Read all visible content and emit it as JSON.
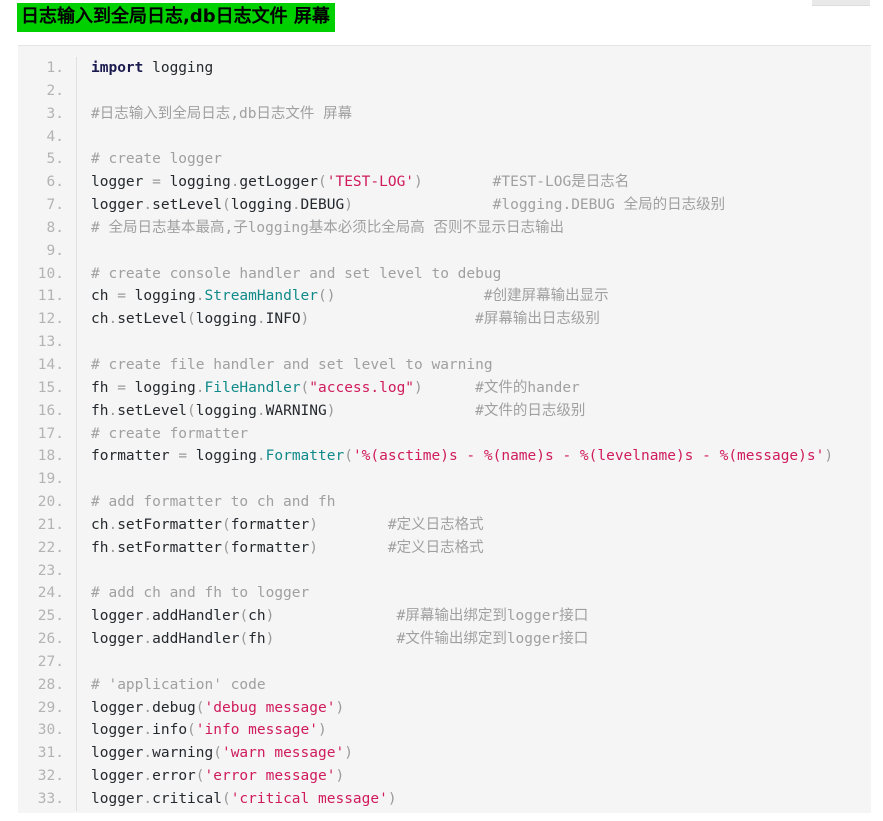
{
  "page_title": "日志输入到全局日志,db日志文件  屏幕",
  "colors": {
    "title_highlight": "#00d000",
    "code_background": "#f5f5f5",
    "gutter_text": "#b3b3b3",
    "comment": "#a0a0a0",
    "string": "#d01b5c",
    "keyword": "#1a1a4e",
    "class_name": "#118a8a",
    "code_text": "#24292e"
  },
  "code_block": {
    "language": "python",
    "line_count": 33,
    "line_number_suffix": ".",
    "lines": [
      {
        "n": "1",
        "tokens": [
          {
            "t": "import",
            "c": "kw"
          },
          {
            "t": " logging",
            "c": "nm"
          }
        ]
      },
      {
        "n": "2",
        "tokens": []
      },
      {
        "n": "3",
        "tokens": [
          {
            "t": "#日志输入到全局日志,db日志文件 屏幕",
            "c": "cm"
          }
        ]
      },
      {
        "n": "4",
        "tokens": []
      },
      {
        "n": "5",
        "tokens": [
          {
            "t": "# create logger",
            "c": "cm"
          }
        ]
      },
      {
        "n": "6",
        "tokens": [
          {
            "t": "logger ",
            "c": "nm"
          },
          {
            "t": "= ",
            "c": "pun"
          },
          {
            "t": "logging",
            "c": "nm"
          },
          {
            "t": ".",
            "c": "pun"
          },
          {
            "t": "getLogger",
            "c": "nm"
          },
          {
            "t": "(",
            "c": "pun"
          },
          {
            "t": "'TEST-LOG'",
            "c": "str"
          },
          {
            "t": ")",
            "c": "pun"
          },
          {
            "t": "        ",
            "c": "nm"
          },
          {
            "t": "#TEST-LOG是日志名",
            "c": "cm"
          }
        ]
      },
      {
        "n": "7",
        "tokens": [
          {
            "t": "logger",
            "c": "nm"
          },
          {
            "t": ".",
            "c": "pun"
          },
          {
            "t": "setLevel",
            "c": "nm"
          },
          {
            "t": "(",
            "c": "pun"
          },
          {
            "t": "logging",
            "c": "nm"
          },
          {
            "t": ".",
            "c": "pun"
          },
          {
            "t": "DEBUG",
            "c": "nm"
          },
          {
            "t": ")",
            "c": "pun"
          },
          {
            "t": "                ",
            "c": "nm"
          },
          {
            "t": "#logging.DEBUG 全局的日志级别",
            "c": "cm"
          }
        ]
      },
      {
        "n": "8",
        "tokens": [
          {
            "t": "# 全局日志基本最高,子logging基本必须比全局高 否则不显示日志输出",
            "c": "cm"
          }
        ]
      },
      {
        "n": "9",
        "tokens": []
      },
      {
        "n": "10",
        "tokens": [
          {
            "t": "# create console handler and set level to debug",
            "c": "cm"
          }
        ]
      },
      {
        "n": "11",
        "tokens": [
          {
            "t": "ch ",
            "c": "nm"
          },
          {
            "t": "= ",
            "c": "pun"
          },
          {
            "t": "logging",
            "c": "nm"
          },
          {
            "t": ".",
            "c": "pun"
          },
          {
            "t": "StreamHandler",
            "c": "cls"
          },
          {
            "t": "()",
            "c": "pun"
          },
          {
            "t": "                 ",
            "c": "nm"
          },
          {
            "t": "#创建屏幕输出显示",
            "c": "cm"
          }
        ]
      },
      {
        "n": "12",
        "tokens": [
          {
            "t": "ch",
            "c": "nm"
          },
          {
            "t": ".",
            "c": "pun"
          },
          {
            "t": "setLevel",
            "c": "nm"
          },
          {
            "t": "(",
            "c": "pun"
          },
          {
            "t": "logging",
            "c": "nm"
          },
          {
            "t": ".",
            "c": "pun"
          },
          {
            "t": "INFO",
            "c": "nm"
          },
          {
            "t": ")",
            "c": "pun"
          },
          {
            "t": "                   ",
            "c": "nm"
          },
          {
            "t": "#屏幕输出日志级别",
            "c": "cm"
          }
        ]
      },
      {
        "n": "13",
        "tokens": []
      },
      {
        "n": "14",
        "tokens": [
          {
            "t": "# create file handler and set level to warning",
            "c": "cm"
          }
        ]
      },
      {
        "n": "15",
        "tokens": [
          {
            "t": "fh ",
            "c": "nm"
          },
          {
            "t": "= ",
            "c": "pun"
          },
          {
            "t": "logging",
            "c": "nm"
          },
          {
            "t": ".",
            "c": "pun"
          },
          {
            "t": "FileHandler",
            "c": "cls"
          },
          {
            "t": "(",
            "c": "pun"
          },
          {
            "t": "\"access.log\"",
            "c": "str"
          },
          {
            "t": ")",
            "c": "pun"
          },
          {
            "t": "      ",
            "c": "nm"
          },
          {
            "t": "#文件的hander",
            "c": "cm"
          }
        ]
      },
      {
        "n": "16",
        "tokens": [
          {
            "t": "fh",
            "c": "nm"
          },
          {
            "t": ".",
            "c": "pun"
          },
          {
            "t": "setLevel",
            "c": "nm"
          },
          {
            "t": "(",
            "c": "pun"
          },
          {
            "t": "logging",
            "c": "nm"
          },
          {
            "t": ".",
            "c": "pun"
          },
          {
            "t": "WARNING",
            "c": "nm"
          },
          {
            "t": ")",
            "c": "pun"
          },
          {
            "t": "                ",
            "c": "nm"
          },
          {
            "t": "#文件的日志级别",
            "c": "cm"
          }
        ]
      },
      {
        "n": "17",
        "tokens": [
          {
            "t": "# create formatter",
            "c": "cm"
          }
        ]
      },
      {
        "n": "18",
        "tokens": [
          {
            "t": "formatter ",
            "c": "nm"
          },
          {
            "t": "= ",
            "c": "pun"
          },
          {
            "t": "logging",
            "c": "nm"
          },
          {
            "t": ".",
            "c": "pun"
          },
          {
            "t": "Formatter",
            "c": "cls"
          },
          {
            "t": "(",
            "c": "pun"
          },
          {
            "t": "'%(asctime)s - %(name)s - %(levelname)s - %(message)s'",
            "c": "str"
          },
          {
            "t": ")",
            "c": "pun"
          }
        ]
      },
      {
        "n": "19",
        "tokens": []
      },
      {
        "n": "20",
        "tokens": [
          {
            "t": "# add formatter to ch and fh",
            "c": "cm"
          }
        ]
      },
      {
        "n": "21",
        "tokens": [
          {
            "t": "ch",
            "c": "nm"
          },
          {
            "t": ".",
            "c": "pun"
          },
          {
            "t": "setFormatter",
            "c": "nm"
          },
          {
            "t": "(",
            "c": "pun"
          },
          {
            "t": "formatter",
            "c": "nm"
          },
          {
            "t": ")",
            "c": "pun"
          },
          {
            "t": "        ",
            "c": "nm"
          },
          {
            "t": "#定义日志格式",
            "c": "cm"
          }
        ]
      },
      {
        "n": "22",
        "tokens": [
          {
            "t": "fh",
            "c": "nm"
          },
          {
            "t": ".",
            "c": "pun"
          },
          {
            "t": "setFormatter",
            "c": "nm"
          },
          {
            "t": "(",
            "c": "pun"
          },
          {
            "t": "formatter",
            "c": "nm"
          },
          {
            "t": ")",
            "c": "pun"
          },
          {
            "t": "        ",
            "c": "nm"
          },
          {
            "t": "#定义日志格式",
            "c": "cm"
          }
        ]
      },
      {
        "n": "23",
        "tokens": []
      },
      {
        "n": "24",
        "tokens": [
          {
            "t": "# add ch and fh to logger",
            "c": "cm"
          }
        ]
      },
      {
        "n": "25",
        "tokens": [
          {
            "t": "logger",
            "c": "nm"
          },
          {
            "t": ".",
            "c": "pun"
          },
          {
            "t": "addHandler",
            "c": "nm"
          },
          {
            "t": "(",
            "c": "pun"
          },
          {
            "t": "ch",
            "c": "nm"
          },
          {
            "t": ")",
            "c": "pun"
          },
          {
            "t": "              ",
            "c": "nm"
          },
          {
            "t": "#屏幕输出绑定到logger接口",
            "c": "cm"
          }
        ]
      },
      {
        "n": "26",
        "tokens": [
          {
            "t": "logger",
            "c": "nm"
          },
          {
            "t": ".",
            "c": "pun"
          },
          {
            "t": "addHandler",
            "c": "nm"
          },
          {
            "t": "(",
            "c": "pun"
          },
          {
            "t": "fh",
            "c": "nm"
          },
          {
            "t": ")",
            "c": "pun"
          },
          {
            "t": "              ",
            "c": "nm"
          },
          {
            "t": "#文件输出绑定到logger接口",
            "c": "cm"
          }
        ]
      },
      {
        "n": "27",
        "tokens": []
      },
      {
        "n": "28",
        "tokens": [
          {
            "t": "# 'application' code",
            "c": "cm"
          }
        ]
      },
      {
        "n": "29",
        "tokens": [
          {
            "t": "logger",
            "c": "nm"
          },
          {
            "t": ".",
            "c": "pun"
          },
          {
            "t": "debug",
            "c": "nm"
          },
          {
            "t": "(",
            "c": "pun"
          },
          {
            "t": "'debug message'",
            "c": "str"
          },
          {
            "t": ")",
            "c": "pun"
          }
        ]
      },
      {
        "n": "30",
        "tokens": [
          {
            "t": "logger",
            "c": "nm"
          },
          {
            "t": ".",
            "c": "pun"
          },
          {
            "t": "info",
            "c": "nm"
          },
          {
            "t": "(",
            "c": "pun"
          },
          {
            "t": "'info message'",
            "c": "str"
          },
          {
            "t": ")",
            "c": "pun"
          }
        ]
      },
      {
        "n": "31",
        "tokens": [
          {
            "t": "logger",
            "c": "nm"
          },
          {
            "t": ".",
            "c": "pun"
          },
          {
            "t": "warning",
            "c": "nm"
          },
          {
            "t": "(",
            "c": "pun"
          },
          {
            "t": "'warn message'",
            "c": "str"
          },
          {
            "t": ")",
            "c": "pun"
          }
        ]
      },
      {
        "n": "32",
        "tokens": [
          {
            "t": "logger",
            "c": "nm"
          },
          {
            "t": ".",
            "c": "pun"
          },
          {
            "t": "error",
            "c": "nm"
          },
          {
            "t": "(",
            "c": "pun"
          },
          {
            "t": "'error message'",
            "c": "str"
          },
          {
            "t": ")",
            "c": "pun"
          }
        ]
      },
      {
        "n": "33",
        "tokens": [
          {
            "t": "logger",
            "c": "nm"
          },
          {
            "t": ".",
            "c": "pun"
          },
          {
            "t": "critical",
            "c": "nm"
          },
          {
            "t": "(",
            "c": "pun"
          },
          {
            "t": "'critical message'",
            "c": "str"
          },
          {
            "t": ")",
            "c": "pun"
          }
        ]
      }
    ]
  }
}
